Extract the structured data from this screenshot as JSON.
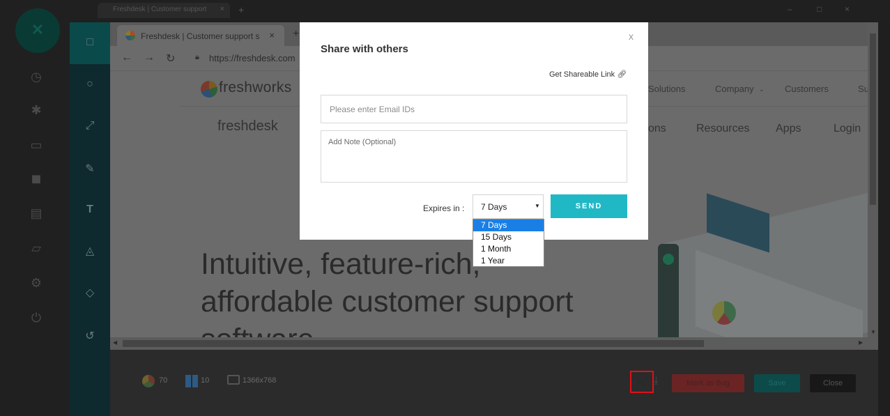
{
  "top_strip": {
    "tab_title": "Freshdesk | Customer support",
    "tab_close": "×",
    "tab_plus": "+",
    "window_controls": [
      "–",
      "□",
      "×"
    ]
  },
  "outer_icons": [
    "clock-icon",
    "bug-icon",
    "video-icon",
    "stop-icon",
    "monitor-icon",
    "folder-icon",
    "gear-icon",
    "power-icon"
  ],
  "tool_icons": [
    "square-icon",
    "circle-icon",
    "arrow-icon",
    "pen-icon",
    "text-icon",
    "fill-icon",
    "eraser-icon",
    "undo-icon"
  ],
  "tool_text_glyph": "T",
  "screenshot": {
    "tab_title": "Freshdesk | Customer support s",
    "tab_close": "×",
    "tab_plus": "+",
    "url": "https://freshdesk.com",
    "freshworks_word": "freshworks",
    "nav_top": [
      "Solutions",
      "Company",
      "Customers",
      "Su"
    ],
    "freshdesk_word": "freshdesk",
    "nav_main": [
      "ons",
      "Resources",
      "Apps",
      "Login"
    ],
    "hero_lines": [
      "Intuitive, feature-rich,",
      "affordable customer support",
      "software"
    ]
  },
  "bottom": {
    "browser_version": "70",
    "os_version": "10",
    "resolution": "1366x768",
    "mark_bug_label": "Mark as Bug",
    "save_label": "Save",
    "close_label": "Close"
  },
  "modal": {
    "title": "Share with others",
    "close": "x",
    "shareable_link": "Get Shareable Link",
    "email_placeholder": "Please enter Email IDs",
    "note_placeholder": "Add Note (Optional)",
    "expires_label": "Expires in :",
    "expires_value": "7 Days",
    "send_label": "SEND",
    "expires_options": [
      "7 Days",
      "15 Days",
      "1 Month",
      "1 Year"
    ]
  },
  "colors": {
    "send_button": "#21b8c6",
    "dropdown_selected": "#1a7fe5",
    "share_highlight": "#e0101a"
  }
}
